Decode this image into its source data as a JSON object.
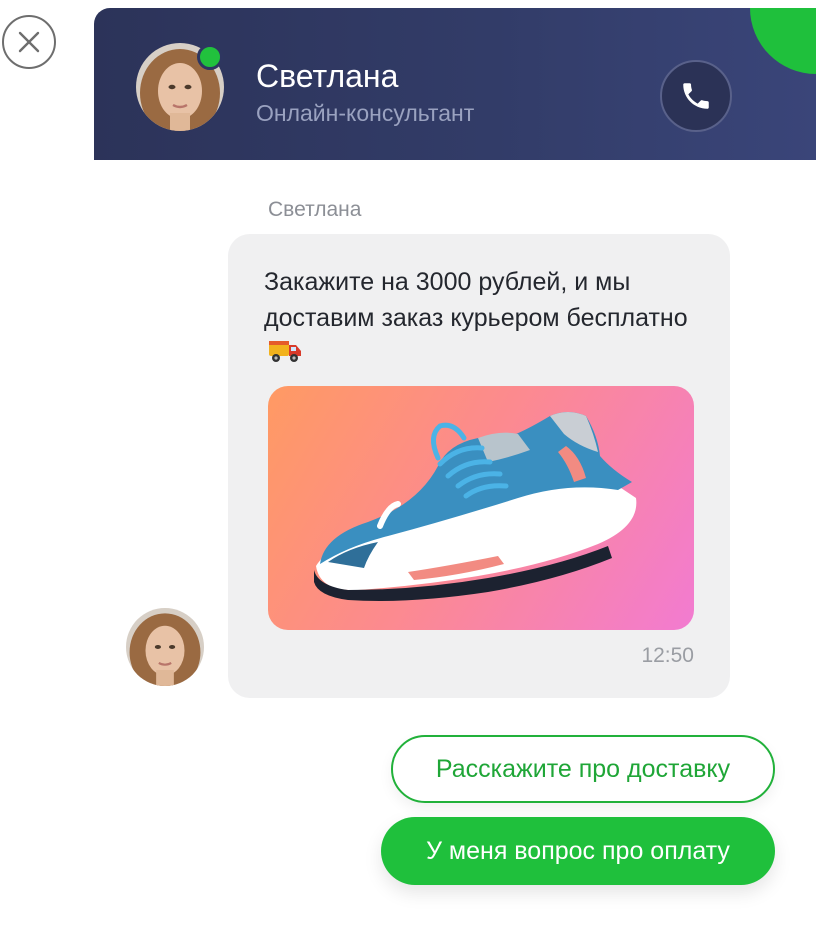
{
  "header": {
    "agent_name": "Светлана",
    "agent_role": "Онлайн-консультант",
    "online": true
  },
  "message": {
    "sender": "Светлана",
    "text": "Закажите на 3000 рублей, и мы доставим заказ курьером бесплатно",
    "time": "12:50",
    "image_alt": "blue running sneaker"
  },
  "quick_replies": [
    {
      "label": "Расскажите про доставку"
    },
    {
      "label": "У меня вопрос про оплату"
    }
  ],
  "icons": {
    "close": "close-icon",
    "phone": "phone-icon",
    "truck": "delivery-truck-icon"
  },
  "colors": {
    "accent": "#1fc03c",
    "header_bg": "#323c68",
    "bubble_bg": "#f0f0f1"
  }
}
